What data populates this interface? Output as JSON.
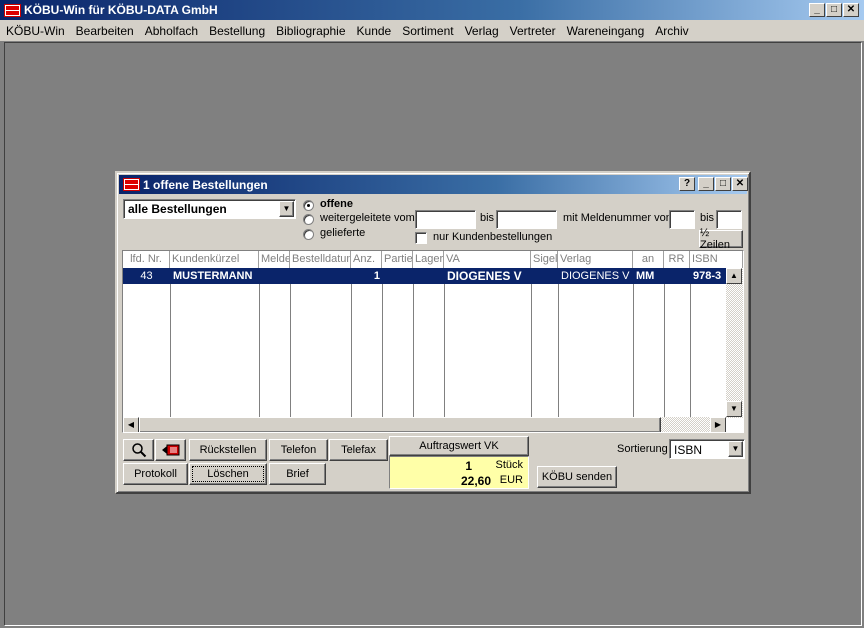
{
  "app": {
    "title": "KÖBU-Win für KÖBU-DATA GmbH",
    "logo_text": "KÖBU"
  },
  "menu": [
    "KÖBU-Win",
    "Bearbeiten",
    "Abholfach",
    "Bestellung",
    "Bibliographie",
    "Kunde",
    "Sortiment",
    "Verlag",
    "Vertreter",
    "Wareneingang",
    "Archiv"
  ],
  "window": {
    "title": "1 offene Bestellungen",
    "help_button": "?",
    "filter_select": "alle Bestellungen",
    "radio_open": "offene",
    "radio_forwarded": "weitergeleitete vom",
    "radio_delivered": "gelieferte",
    "label_bis": "bis",
    "label_meldenummer": "mit Meldenummer von",
    "label_bis2": "bis",
    "checkbox_customer_only": "nur Kundenbestellungen",
    "half_rows_button": "½ Zeilen"
  },
  "grid": {
    "headers": [
      "lfd. Nr.",
      "Kundenkürzel",
      "Melde",
      "Bestelldatum",
      "Anz.",
      "Partie",
      "Lager",
      "VA",
      "Sigel",
      "Verlag",
      "an",
      "RR",
      "ISBN"
    ],
    "rows": [
      {
        "lfd": "43",
        "kunde": "MUSTERMANN",
        "melde": "",
        "datum": "",
        "anz": "1",
        "partie": "",
        "lager": "",
        "va": "DIOGENES V",
        "sigel": "",
        "verlag": "DIOGENES V",
        "an": "MM",
        "rr": "",
        "isbn": "978-3"
      }
    ]
  },
  "toolbar": {
    "search_icon": "magnifier-icon",
    "back_icon": "return-arrow-icon",
    "zurueckstellen": "Rückstellen",
    "telefon": "Telefon",
    "telefax": "Telefax",
    "protokoll": "Protokoll",
    "loeschen": "Löschen",
    "brief": "Brief",
    "auftragswert": "Auftragswert VK",
    "quantity": "1",
    "quantity_unit": "Stück",
    "amount": "22,60",
    "currency": "EUR",
    "sortierung_label": "Sortierung",
    "sortierung_value": "ISBN",
    "koebu_senden": "KÖBU senden"
  }
}
